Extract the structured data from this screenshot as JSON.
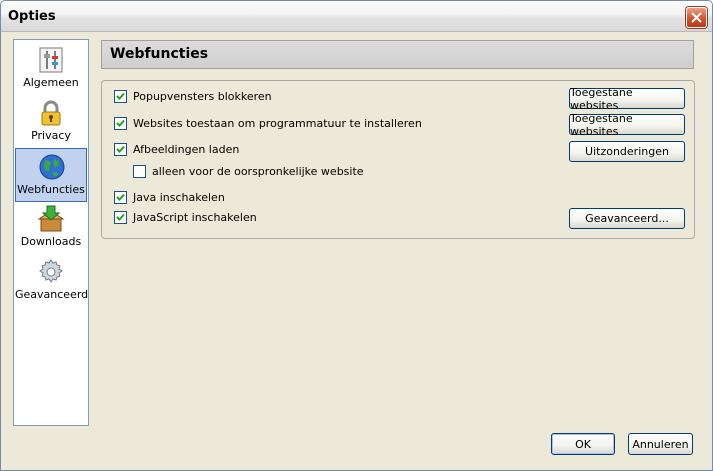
{
  "window": {
    "title": "Opties"
  },
  "sidebar": {
    "items": [
      {
        "label": "Algemeen",
        "icon": "sliders-icon"
      },
      {
        "label": "Privacy",
        "icon": "padlock-icon"
      },
      {
        "label": "Webfuncties",
        "icon": "globe-icon",
        "selected": true
      },
      {
        "label": "Downloads",
        "icon": "download-box-icon"
      },
      {
        "label": "Geavanceerd",
        "icon": "gear-icon"
      }
    ]
  },
  "panel": {
    "title": "Webfuncties",
    "options": [
      {
        "label": "Popupvensters blokkeren",
        "checked": true
      },
      {
        "label": "Websites toestaan om programmatuur te installeren",
        "checked": true
      },
      {
        "label": "Afbeeldingen laden",
        "checked": true
      },
      {
        "label": "alleen voor de oorspronkelijke website",
        "checked": false
      },
      {
        "label": "Java inschakelen",
        "checked": true
      },
      {
        "label": "JavaScript inschakelen",
        "checked": true
      }
    ],
    "buttons": {
      "popup_exceptions": "Toegestane websites",
      "install_exceptions": "Toegestane websites",
      "image_exceptions": "Uitzonderingen",
      "advanced_js": "Geavanceerd..."
    }
  },
  "footer": {
    "ok": "OK",
    "cancel": "Annuleren"
  },
  "colors": {
    "selection": "#c1d2ee",
    "accent": "#316ac5",
    "close": "#d0552f"
  }
}
